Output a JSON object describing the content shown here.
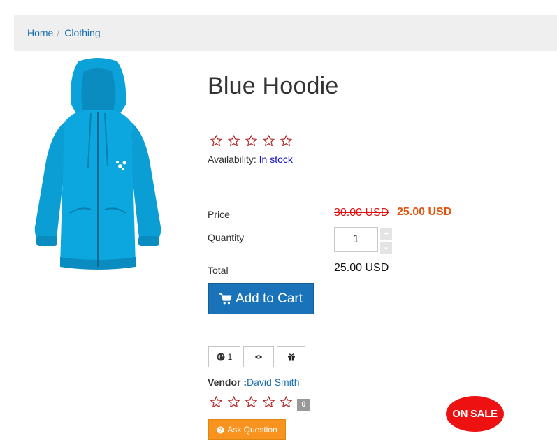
{
  "breadcrumb": {
    "home": "Home",
    "separator": "/",
    "category": "Clothing"
  },
  "product": {
    "title": "Blue Hoodie",
    "image_icon": "blue-hoodie-image",
    "rating": 0,
    "availability_label": "Availability:",
    "availability_value": "In stock",
    "price_label": "Price",
    "old_price": "30.00 USD",
    "sale_price": "25.00 USD",
    "quantity_label": "Quantity",
    "quantity_value": "1",
    "qty_plus": "+",
    "qty_minus": "-",
    "total_label": "Total",
    "total_value": "25.00 USD"
  },
  "actions": {
    "add_to_cart": "Add to Cart",
    "globe_count": "1",
    "ask_question": "Ask Question"
  },
  "vendor": {
    "label": "Vendor :",
    "name": "David Smith"
  },
  "reviews": {
    "rating": 0,
    "count": "0"
  },
  "badge": {
    "text": "ON SALE"
  },
  "colors": {
    "accent_blue": "#1a73b8",
    "link_blue": "#1a6faf",
    "sale_red": "#ee1111",
    "old_price_red": "#e01010",
    "sale_price_orange": "#e0560f",
    "ask_orange": "#f7931e",
    "star_outline": "#b02020"
  }
}
